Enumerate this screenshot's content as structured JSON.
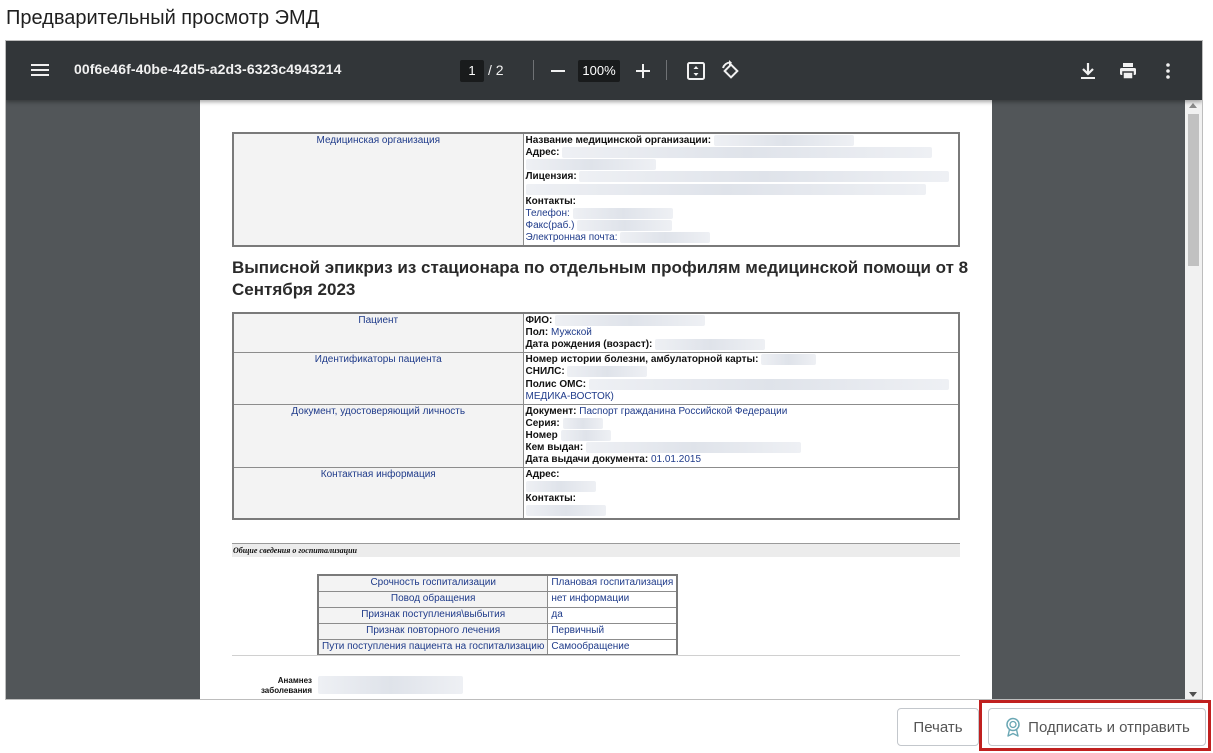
{
  "page_title": "Предварительный просмотр ЭМД",
  "viewer": {
    "file_name": "00f6e46f-40be-42d5-a2d3-6323c4943214",
    "current_page": "1",
    "page_separator": "/",
    "total_pages": "2",
    "zoom": "100%",
    "icons": [
      "menu-icon",
      "zoom-out-icon",
      "zoom-in-icon",
      "fit-page-icon",
      "rotate-icon",
      "download-icon",
      "print-icon",
      "more-icon"
    ]
  },
  "document": {
    "org_table": {
      "label": "Медицинская организация",
      "name_label": "Название медицинской организации:",
      "address_label": "Адрес:",
      "license_label": "Лицензия:",
      "contacts_label": "Контакты:",
      "phone_label": "Телефон:",
      "fax_label": "Факс(раб.)",
      "email_label": "Электронная почта:"
    },
    "heading": "Выписной эпикриз из стационара по отдельным профилям медицинской помощи от 8 Сентября 2023",
    "patient_table": {
      "patient_label": "Пациент",
      "fio_label": "ФИО:",
      "sex_label": "Пол:",
      "sex_value": "Мужской",
      "dob_label": "Дата рождения (возраст):",
      "ids_label": "Идентификаторы пациента",
      "history_label": "Номер истории болезни, амбулаторной карты:",
      "snils_label": "СНИЛС:",
      "oms_label": "Полис ОМС:",
      "oms_tail": "МЕДИКА-ВОСТОК)",
      "doc_label": "Документ, удостоверяющий личность",
      "document_label": "Документ:",
      "document_value": "Паспорт гражданина Российской Федерации",
      "series_label": "Серия:",
      "number_label": "Номер",
      "issued_by_label": "Кем выдан:",
      "issue_date_label": "Дата выдачи документа:",
      "issue_date_value": "01.01.2015",
      "contact_info_label": "Контактная информация",
      "contact_address_label": "Адрес:",
      "contact_contacts_label": "Контакты:"
    },
    "section_title": "Общие сведения о госпитализации",
    "hospitalization": [
      {
        "key": "Срочность госпитализации",
        "value": "Плановая госпитализация"
      },
      {
        "key": "Повод обращения",
        "value": "нет информации"
      },
      {
        "key": "Признак поступления\\выбытия",
        "value": "да"
      },
      {
        "key": "Признак повторного лечения",
        "value": "Первичный"
      },
      {
        "key": "Пути поступления пациента на госпитализацию",
        "value": "Самообращение"
      }
    ],
    "anamnesis_label_1": "Анамнез",
    "anamnesis_label_2": "заболевания"
  },
  "buttons": {
    "print": "Печать",
    "sign_and_send": "Подписать и отправить"
  },
  "colors": {
    "toolbar_bg": "#323639",
    "viewer_bg": "#525659",
    "highlight": "#c0201f",
    "doc_text": "#1f3b8a"
  }
}
